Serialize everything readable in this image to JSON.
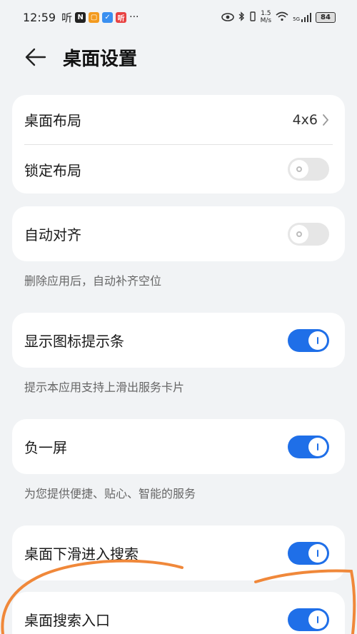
{
  "status_bar": {
    "time": "12:59",
    "ting_label": "听",
    "network_speed_value": "1.5",
    "network_speed_unit": "M/s",
    "signal_label": "5G",
    "battery": "84"
  },
  "header": {
    "title": "桌面设置"
  },
  "settings": {
    "layout_label": "桌面布局",
    "layout_value": "4x6",
    "lock_layout_label": "锁定布局",
    "lock_layout_on": false,
    "auto_align_label": "自动对齐",
    "auto_align_on": false,
    "auto_align_desc": "删除应用后，自动补齐空位",
    "icon_hint_label": "显示图标提示条",
    "icon_hint_on": true,
    "icon_hint_desc": "提示本应用支持上滑出服务卡片",
    "minus_one_label": "负一屏",
    "minus_one_on": true,
    "minus_one_desc": "为您提供便捷、贴心、智能的服务",
    "swipe_search_label": "桌面下滑进入搜索",
    "swipe_search_on": true,
    "search_entry_label": "桌面搜索入口",
    "search_entry_on": true
  },
  "colors": {
    "accent": "#1f6fe8",
    "annotation": "#f0883a"
  }
}
